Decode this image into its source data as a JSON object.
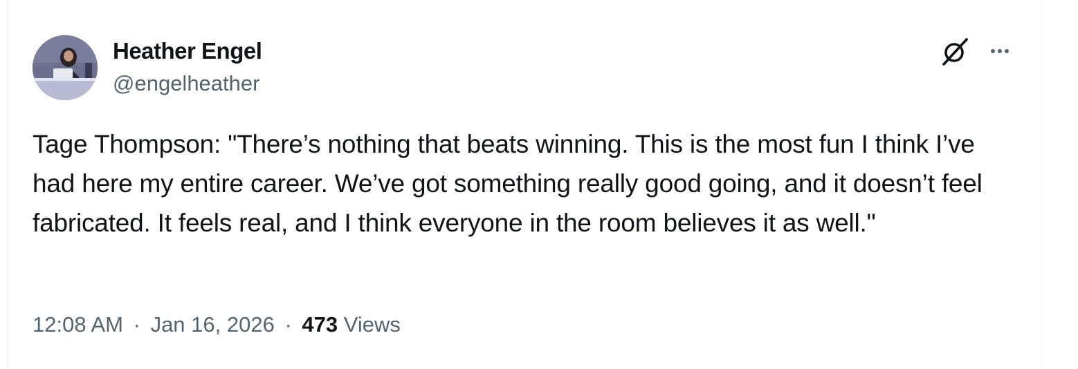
{
  "author": {
    "display_name": "Heather Engel",
    "handle": "@engelheather"
  },
  "icons": {
    "grok": "grok-icon",
    "more": "more-options-icon"
  },
  "tweet": {
    "text": "Tage Thompson: \"There’s nothing that beats winning. This is the most fun I think I’ve had here my entire career. We’ve got something really good going, and it doesn’t feel fabricated. It feels real, and I think everyone in the room believes it as well.\""
  },
  "meta": {
    "time": "12:08 AM",
    "separator": "·",
    "date": "Jan 16, 2026",
    "views_count": "473",
    "views_label": "Views"
  },
  "colors": {
    "text_primary": "#0f1419",
    "text_secondary": "#536471",
    "border": "#eff3f4"
  }
}
